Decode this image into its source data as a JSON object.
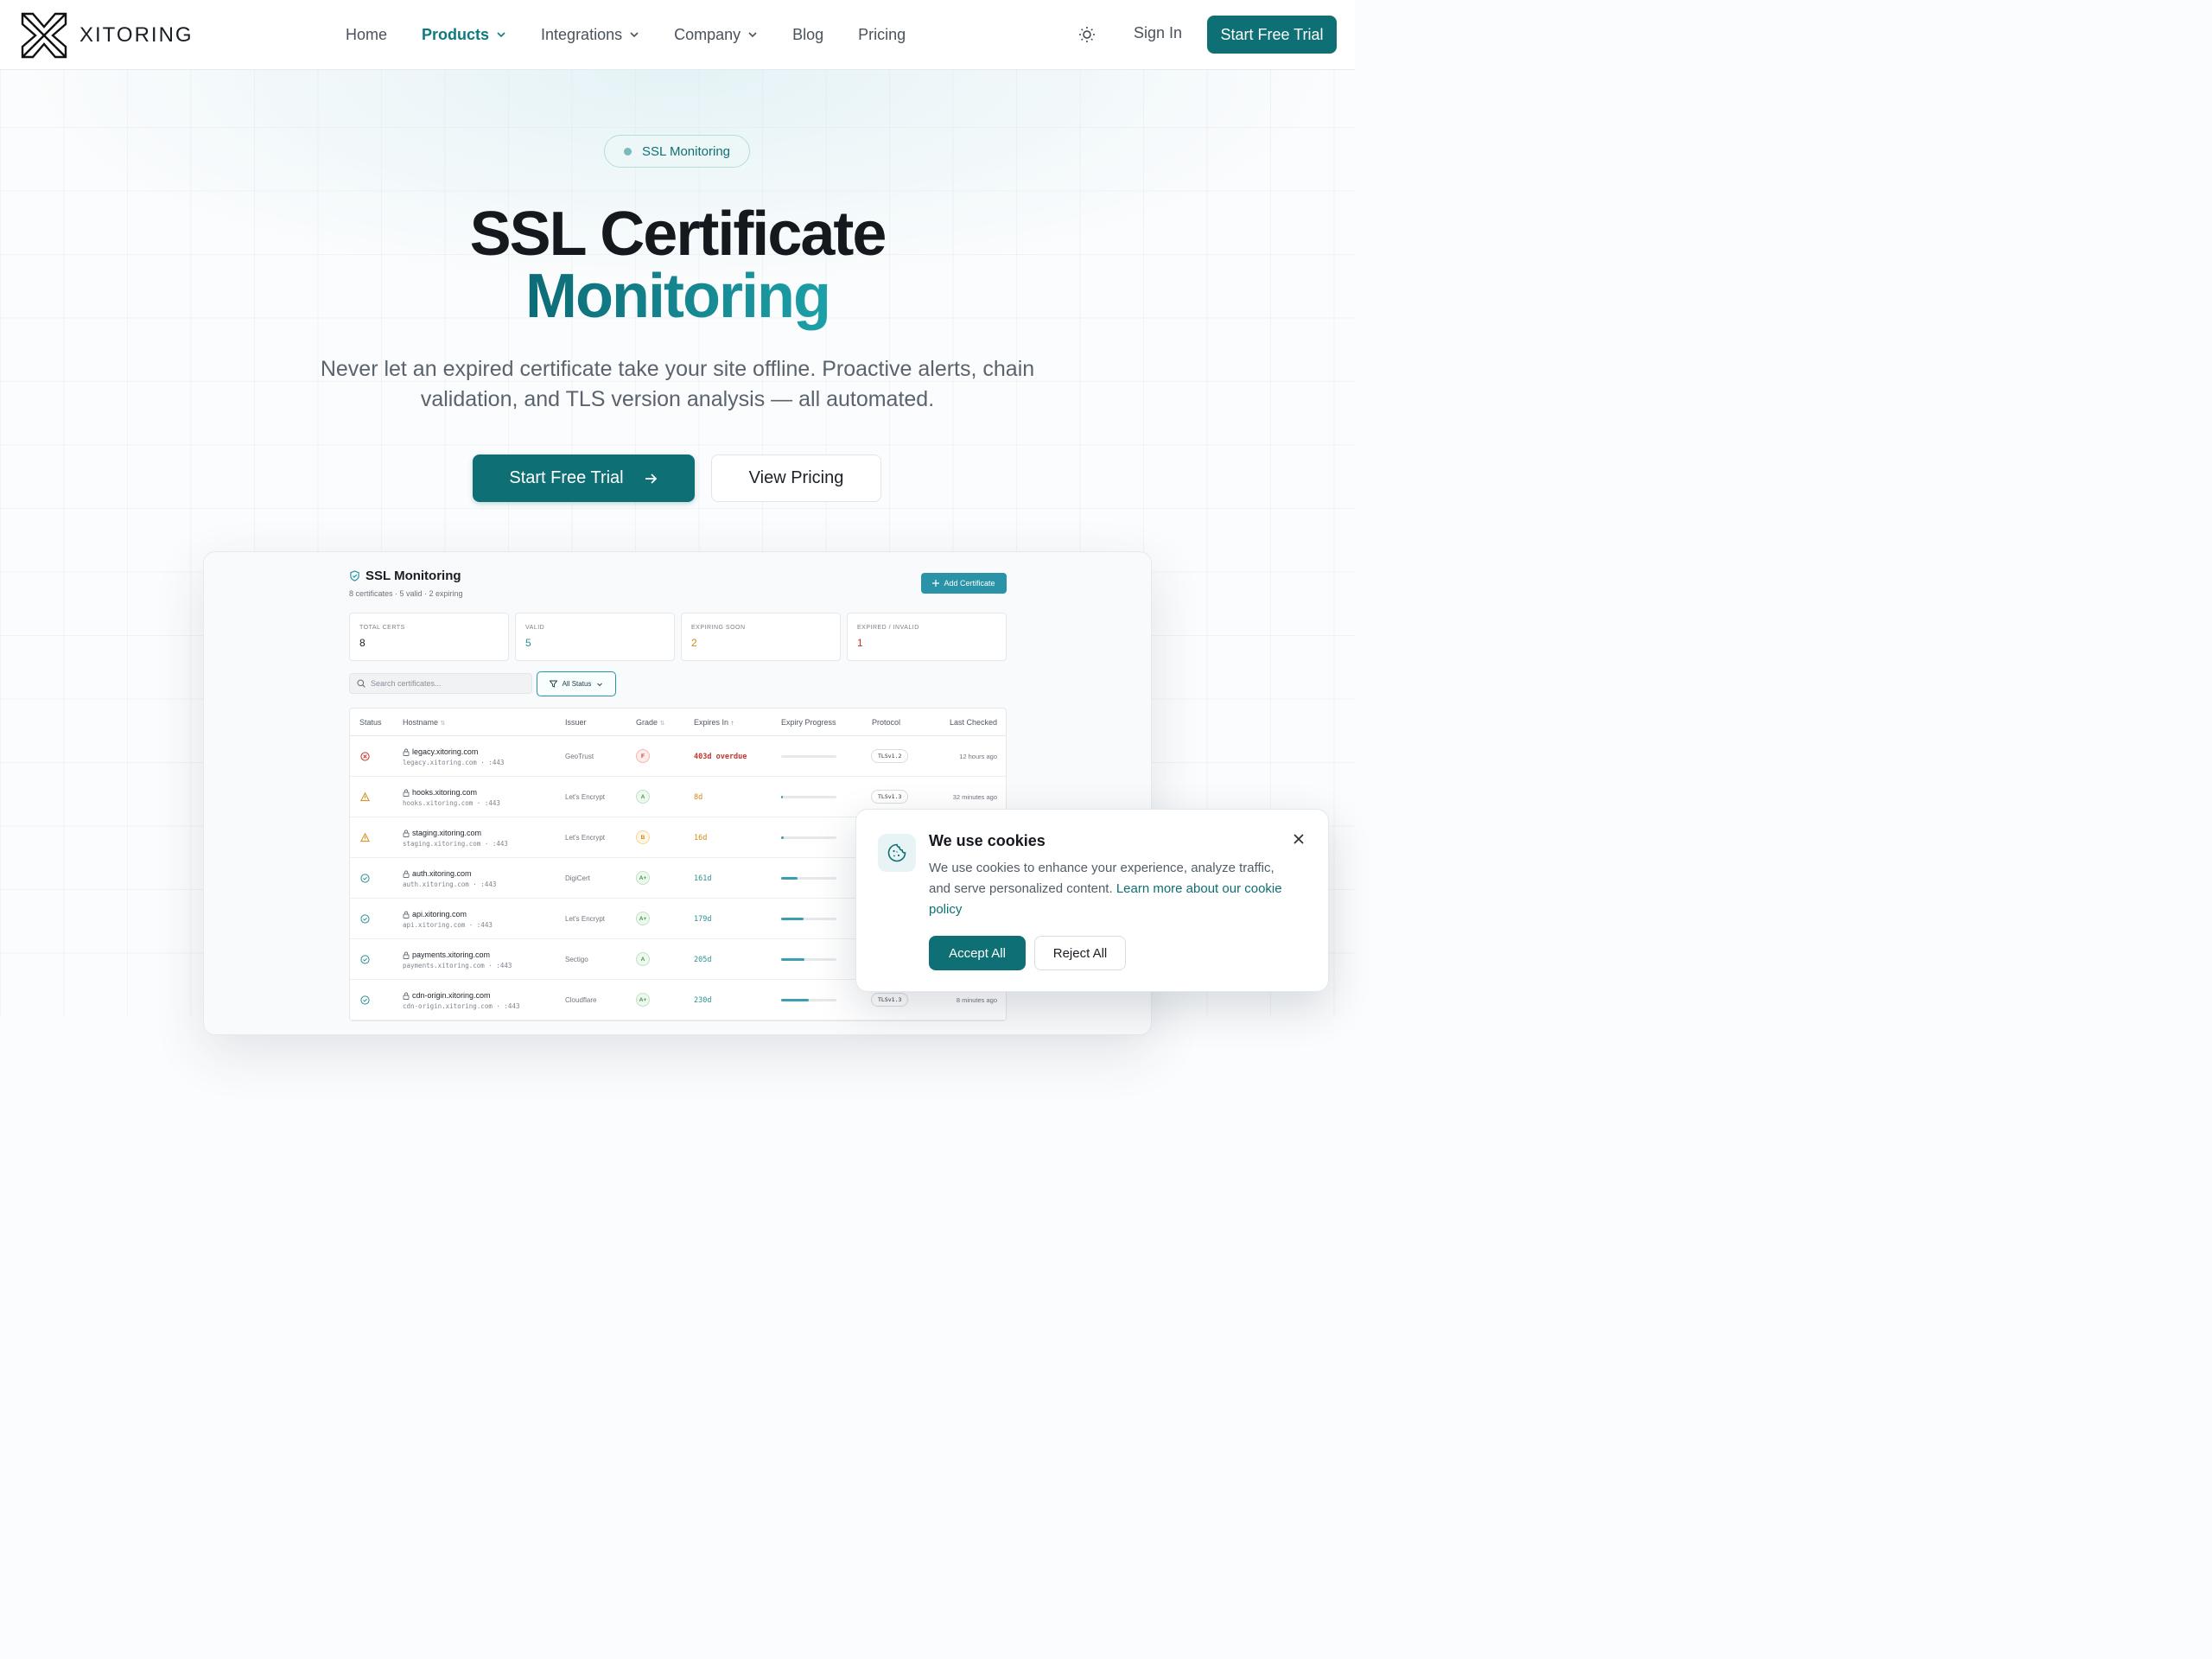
{
  "nav": {
    "logo_text": "XITORING",
    "links": [
      {
        "label": "Home"
      },
      {
        "label": "Products"
      },
      {
        "label": "Integrations"
      },
      {
        "label": "Company"
      },
      {
        "label": "Blog"
      },
      {
        "label": "Pricing"
      }
    ],
    "sign_in": "Sign In",
    "cta": "Start Free Trial"
  },
  "hero": {
    "badge": "SSL Monitoring",
    "title_line1": "SSL Certificate",
    "title_line2": "Monitoring",
    "subtitle": "Never let an expired certificate take your site offline. Proactive alerts, chain validation, and TLS version analysis — all automated.",
    "primary_button": "Start Free Trial",
    "secondary_button": "View Pricing"
  },
  "dashboard": {
    "title": "SSL Monitoring",
    "summary": "8 certificates · 5 valid · 2 expiring",
    "add_button": "Add Certificate",
    "stats": [
      {
        "label": "TOTAL CERTS",
        "value": "8",
        "color": "#1a1e24"
      },
      {
        "label": "VALID",
        "value": "5",
        "color": "#2b8f8f"
      },
      {
        "label": "EXPIRING SOON",
        "value": "2",
        "color": "#d08a12"
      },
      {
        "label": "EXPIRED / INVALID",
        "value": "1",
        "color": "#c2362e"
      }
    ],
    "search_placeholder": "Search certificates...",
    "filter_label": "All Status",
    "columns": {
      "status": "Status",
      "hostname": "Hostname",
      "issuer": "Issuer",
      "grade": "Grade",
      "expires": "Expires In",
      "progress": "Expiry Progress",
      "protocol": "Protocol",
      "checked": "Last Checked"
    },
    "rows": [
      {
        "status": "error",
        "host": "legacy.xitoring.com",
        "sub": "legacy.xitoring.com · :443",
        "issuer": "GeoTrust",
        "grade": "F",
        "expires": "403d overdue",
        "progress": 0,
        "protocol": "TLSv1.2",
        "checked": "12 hours ago"
      },
      {
        "status": "warning",
        "host": "hooks.xitoring.com",
        "sub": "hooks.xitoring.com · :443",
        "issuer": "Let's Encrypt",
        "grade": "A",
        "expires": "8d",
        "progress": 0.03,
        "protocol": "TLSv1.3",
        "checked": "32 minutes ago"
      },
      {
        "status": "warning",
        "host": "staging.xitoring.com",
        "sub": "staging.xitoring.com · :443",
        "issuer": "Let's Encrypt",
        "grade": "B",
        "expires": "16d",
        "progress": 0.05,
        "protocol": "",
        "checked": ""
      },
      {
        "status": "ok",
        "host": "auth.xitoring.com",
        "sub": "auth.xitoring.com · :443",
        "issuer": "DigiCert",
        "grade": "A+",
        "expires": "161d",
        "progress": 0.3,
        "protocol": "",
        "checked": ""
      },
      {
        "status": "ok",
        "host": "api.xitoring.com",
        "sub": "api.xitoring.com · :443",
        "issuer": "Let's Encrypt",
        "grade": "A+",
        "expires": "179d",
        "progress": 0.4,
        "protocol": "",
        "checked": ""
      },
      {
        "status": "ok",
        "host": "payments.xitoring.com",
        "sub": "payments.xitoring.com · :443",
        "issuer": "Sectigo",
        "grade": "A",
        "expires": "205d",
        "progress": 0.42,
        "protocol": "",
        "checked": ""
      },
      {
        "status": "ok",
        "host": "cdn-origin.xitoring.com",
        "sub": "cdn-origin.xitoring.com · :443",
        "issuer": "Cloudflare",
        "grade": "A+",
        "expires": "230d",
        "progress": 0.5,
        "protocol": "TLSv1.3",
        "checked": "8 minutes ago"
      }
    ]
  },
  "cookie": {
    "title": "We use cookies",
    "body": "We use cookies to enhance your experience, analyze traffic, and serve personalized content. ",
    "link": "Learn more about our cookie policy",
    "accept": "Accept All",
    "reject": "Reject All"
  },
  "colors": {
    "brand": "#0e6f74",
    "error": "#c2362e",
    "warning": "#d08a12",
    "ok": "#2b8f8f"
  }
}
